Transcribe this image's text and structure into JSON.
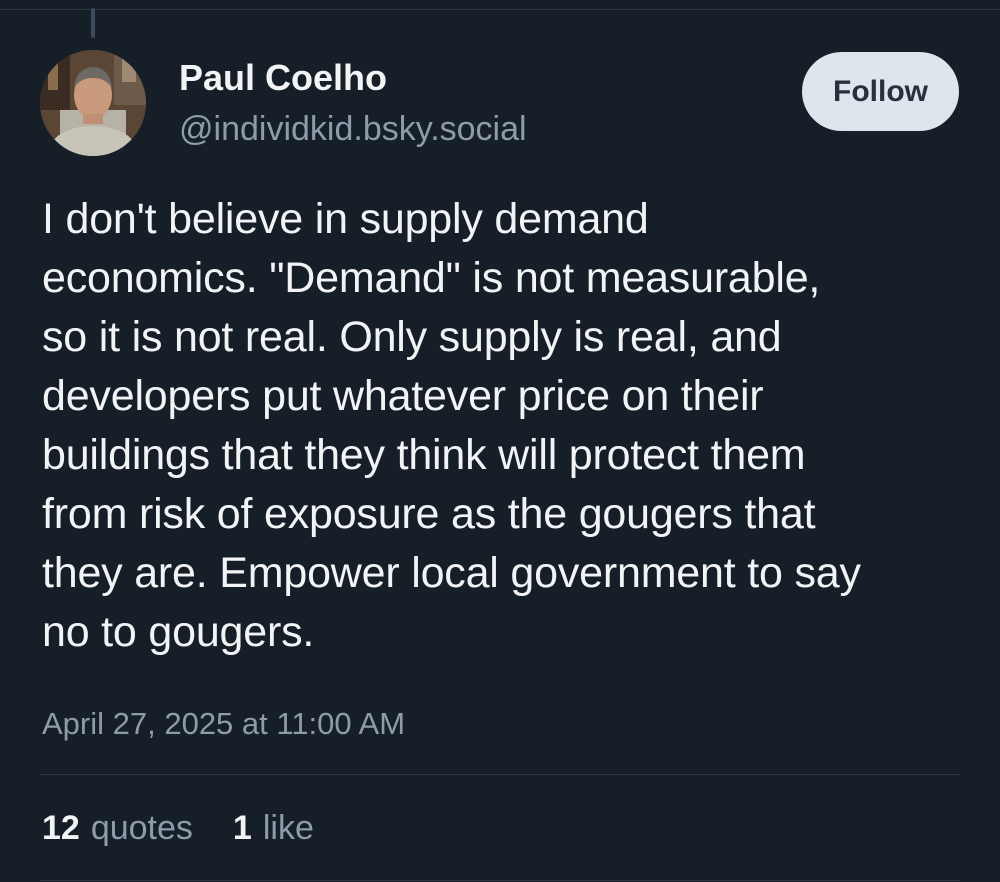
{
  "post": {
    "author": {
      "name": "Paul Coelho",
      "handle": "@individkid.bsky.social",
      "avatar_icon": "profile-photo-avatar"
    },
    "follow_label": "Follow",
    "text_lines": [
      "I don't believe in supply demand",
      "economics. \"Demand\" is not measurable,",
      "so it is not real. Only supply is real, and",
      "developers put whatever price on their",
      "buildings that they think will protect them",
      "from risk of exposure as the gougers that",
      "they are. Empower local government to say",
      "no to gougers."
    ],
    "timestamp": "April 27, 2025 at 11:00 AM",
    "stats": {
      "quotes_count": "12",
      "quotes_label": "quotes",
      "likes_count": "1",
      "likes_label": "like"
    }
  },
  "colors": {
    "background": "#161e27",
    "text_primary": "#f1f3f5",
    "text_secondary": "#8d9bab",
    "follow_button_bg": "#dfe5ec"
  }
}
